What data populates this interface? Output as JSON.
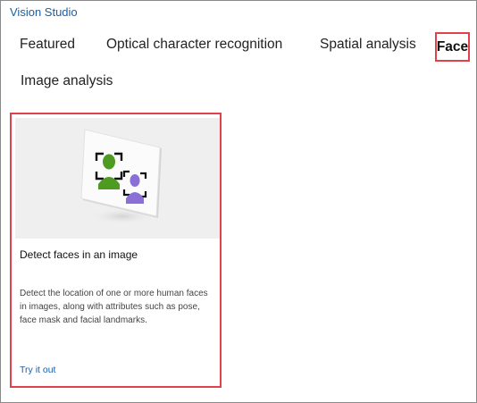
{
  "app": {
    "title": "Vision Studio"
  },
  "tabs": [
    {
      "label": "Featured",
      "selected": false
    },
    {
      "label": "Optical character recognition",
      "selected": false
    },
    {
      "label": "Spatial analysis",
      "selected": false
    },
    {
      "label": "Face",
      "selected": true
    },
    {
      "label": "Image analysis",
      "selected": false
    }
  ],
  "cards": [
    {
      "title": "Detect faces in an image",
      "description": "Detect the location of one or more human faces in images, along with attributes such as pose, face mask and facial landmarks.",
      "link": "Try it out",
      "icon": "face-detection-illustration"
    }
  ],
  "colors": {
    "accent_link": "#1a5ea8",
    "highlight_border": "#e0414c",
    "face_green": "#4e9b22",
    "face_purple": "#8a6fd6"
  }
}
